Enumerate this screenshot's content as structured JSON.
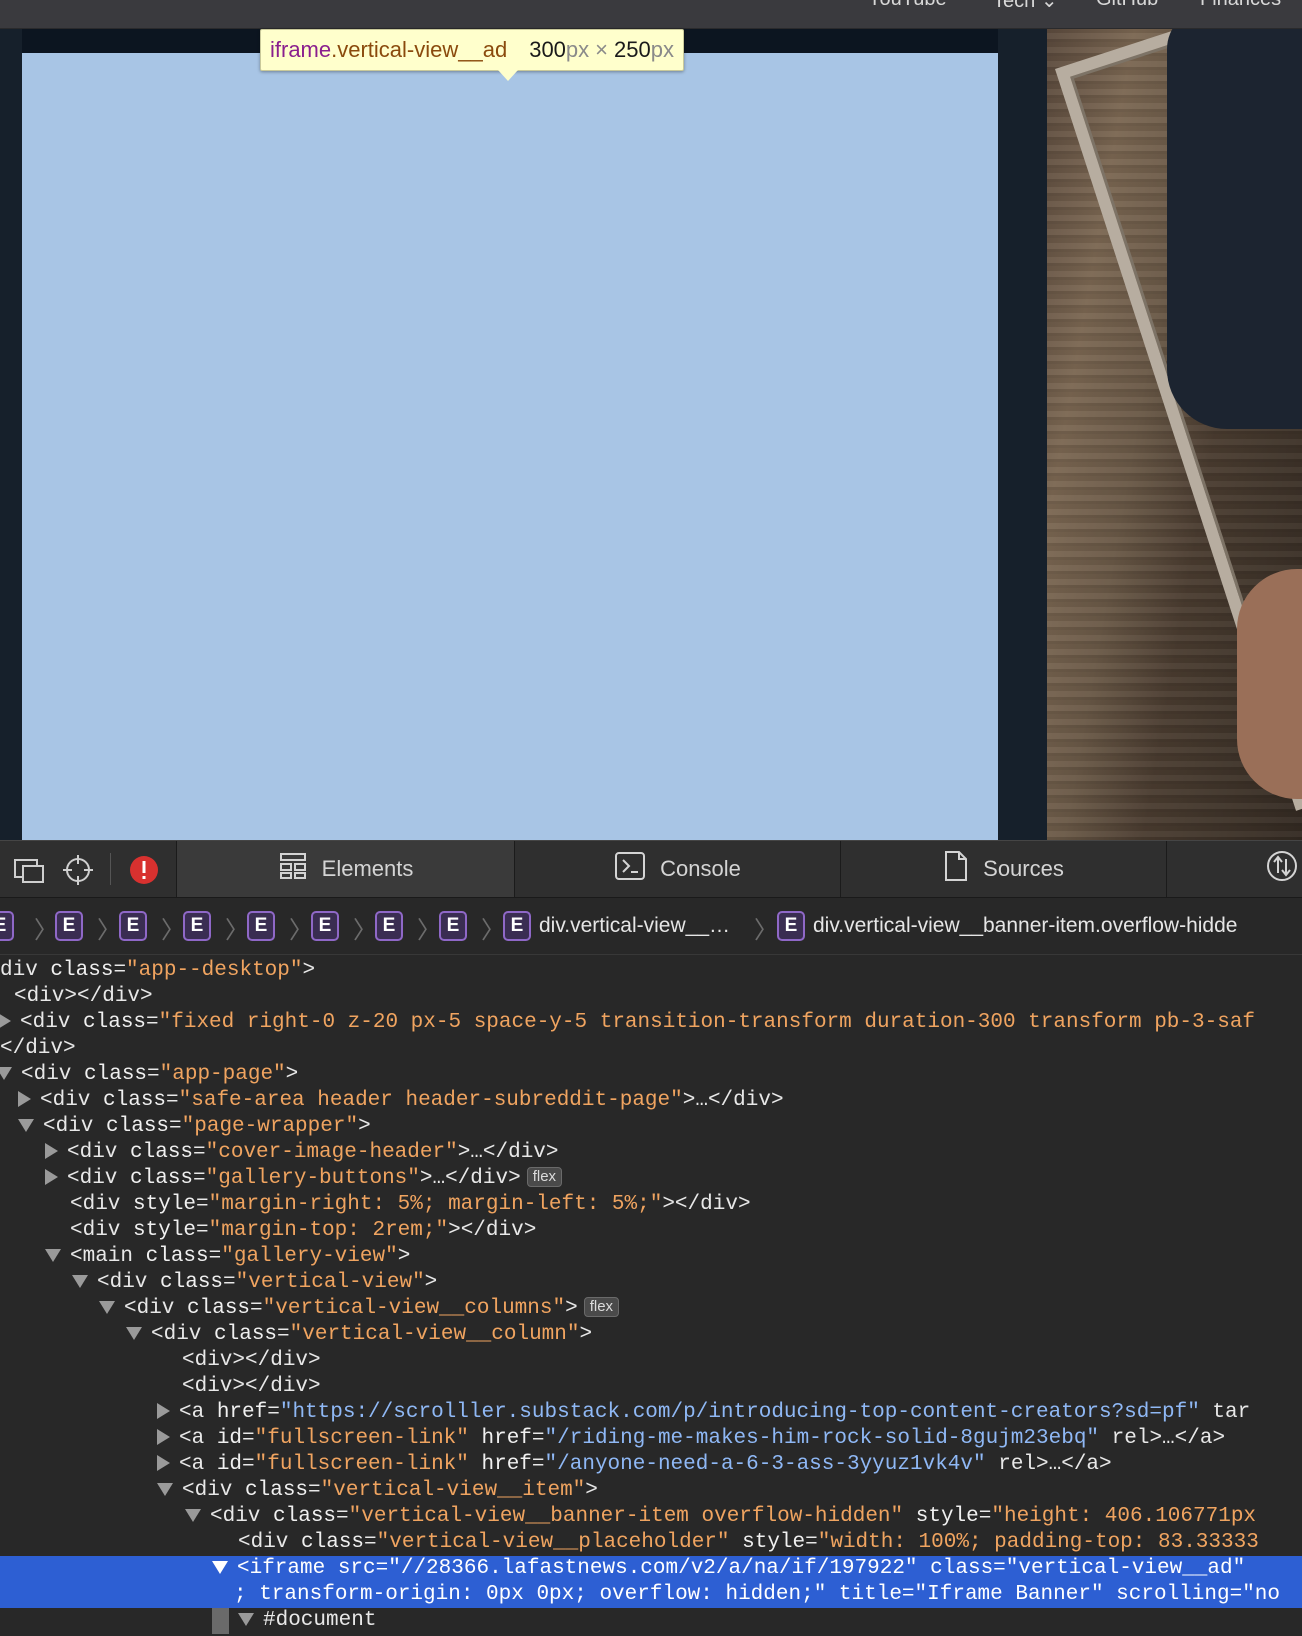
{
  "top_nav": {
    "links": [
      "YouTube",
      "Tech",
      "GitHub",
      "Finances"
    ]
  },
  "tooltip": {
    "tag": "iframe",
    "class_name": ".vertical-view__ad",
    "width": "300",
    "height": "250",
    "unit": "px",
    "times": "×"
  },
  "devtools": {
    "tools": [
      "responsive-mode-icon",
      "element-picker-icon",
      "error-icon"
    ],
    "tabs": [
      {
        "label": "Elements",
        "icon": "elements-icon",
        "active": true
      },
      {
        "label": "Console",
        "icon": "console-icon",
        "active": false
      },
      {
        "label": "Sources",
        "icon": "sources-icon",
        "active": false
      }
    ],
    "breadcrumb": {
      "badge": "E",
      "items": [
        "div.vertical-view__…",
        "div.vertical-view__banner-item.overflow-hidde"
      ]
    },
    "tree": [
      {
        "text": "div class=\"app--desktop\">"
      },
      {
        "text": "<div></div>"
      },
      {
        "text": "<div class=\"fixed right-0 z-20 px-5 space-y-5 transition-transform duration-300 transform pb-3-saf"
      },
      {
        "text": "</div>"
      },
      {
        "text": "<div class=\"app-page\">"
      },
      {
        "text": "<div class=\"safe-area header header-subreddit-page\">…</div>"
      },
      {
        "text": "<div class=\"page-wrapper\">"
      },
      {
        "text": "<div class=\"cover-image-header\">…</div>"
      },
      {
        "text": "<div class=\"gallery-buttons\">…</div>",
        "badge": "flex"
      },
      {
        "text": "<div style=\"margin-right: 5%; margin-left: 5%;\"></div>"
      },
      {
        "text": "<div style=\"margin-top: 2rem;\"></div>"
      },
      {
        "text": "<main class=\"gallery-view\">"
      },
      {
        "text": "<div class=\"vertical-view\">"
      },
      {
        "text": "<div class=\"vertical-view__columns\">",
        "badge": "flex"
      },
      {
        "text": "<div class=\"vertical-view__column\">"
      },
      {
        "text": "<div></div>"
      },
      {
        "text": "<div></div>"
      },
      {
        "text": "<a href=\"https://scrolller.substack.com/p/introducing-top-content-creators?sd=pf\" tar"
      },
      {
        "text": "<a id=\"fullscreen-link\" href=\"/riding-me-makes-him-rock-solid-8gujm23ebq\" rel>…</a>"
      },
      {
        "text": "<a id=\"fullscreen-link\" href=\"/anyone-need-a-6-3-ass-3yyuz1vk4v\" rel>…</a>"
      },
      {
        "text": "<div class=\"vertical-view__item\">"
      },
      {
        "text": "<div class=\"vertical-view__banner-item overflow-hidden\" style=\"height: 406.106771px"
      },
      {
        "text": "<div class=\"vertical-view__placeholder\" style=\"width: 100%; padding-top: 83.33333"
      },
      {
        "text": "<iframe src=\"//28366.lafastnews.com/v2/a/na/if/197922\" class=\"vertical-view__ad\""
      },
      {
        "text": "; transform-origin: 0px 0px; overflow: hidden;\" title=\"Iframe Banner\" scrolling=\"no"
      },
      {
        "text": "#document"
      }
    ]
  }
}
